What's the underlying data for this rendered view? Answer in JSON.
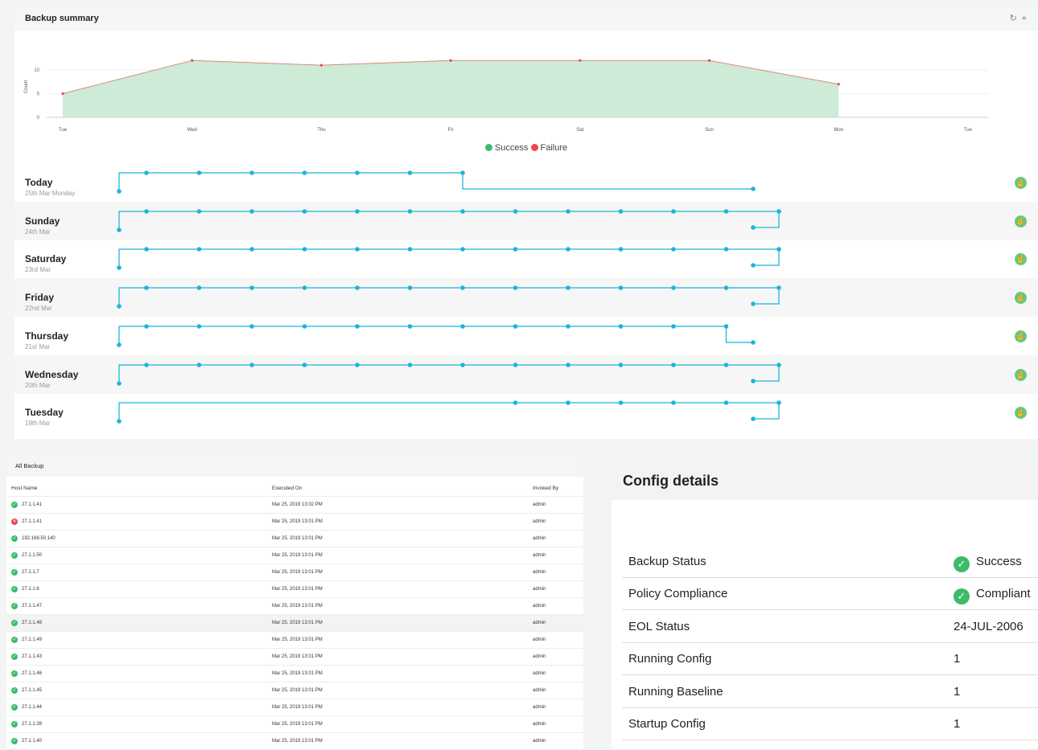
{
  "summary": {
    "title": "Backup summary",
    "icons": [
      "refresh-icon",
      "pin-icon"
    ],
    "ylabel": "Count",
    "legend": [
      {
        "label": "Success",
        "color": "#3dbb6a"
      },
      {
        "label": "Failure",
        "color": "#e8474f"
      }
    ]
  },
  "chart_data": {
    "type": "area",
    "categories": [
      "Tue",
      "Wed",
      "Thu",
      "Fri",
      "Sat",
      "Sun",
      "Mon",
      "Tue"
    ],
    "series": [
      {
        "name": "Success",
        "color": "#3dbb6a",
        "values": [
          5,
          12,
          11,
          12,
          12,
          12,
          7,
          null
        ]
      },
      {
        "name": "Failure",
        "color": "#e8474f",
        "values": [
          0,
          0,
          0,
          0,
          0,
          0,
          0,
          null
        ]
      }
    ],
    "yticks": [
      0,
      5,
      10
    ],
    "ylim": [
      0,
      12
    ],
    "ylabel": "Count",
    "xlabel": "",
    "grid": true,
    "legend": "bottom-center"
  },
  "timeline": {
    "line_color": "#1bb5db",
    "days": [
      {
        "day": "Today",
        "date": "25th Mar Monday",
        "status": "up-vote",
        "slots": [
          1,
          1,
          1,
          1,
          1,
          1,
          1,
          0,
          0,
          0,
          0,
          0,
          0
        ],
        "last_index": 6
      },
      {
        "day": "Sunday",
        "date": "24th Mar",
        "status": "up-vote",
        "slots": [
          1,
          1,
          1,
          1,
          1,
          1,
          1,
          1,
          1,
          1,
          1,
          1,
          1
        ],
        "last_index": 12
      },
      {
        "day": "Saturday",
        "date": "23rd Mar",
        "status": "up-vote",
        "slots": [
          1,
          1,
          1,
          1,
          1,
          1,
          1,
          1,
          1,
          1,
          1,
          1,
          1
        ],
        "last_index": 12
      },
      {
        "day": "Friday",
        "date": "22nd Mar",
        "status": "up-vote",
        "slots": [
          1,
          1,
          1,
          1,
          1,
          1,
          1,
          1,
          1,
          1,
          1,
          1,
          1
        ],
        "last_index": 12
      },
      {
        "day": "Thursday",
        "date": "21st Mar",
        "status": "up-vote",
        "slots": [
          1,
          1,
          1,
          1,
          1,
          1,
          1,
          1,
          1,
          1,
          1,
          1,
          0
        ],
        "last_index": 11
      },
      {
        "day": "Wednesday",
        "date": "20th Mar",
        "status": "up-vote",
        "slots": [
          1,
          1,
          1,
          1,
          1,
          1,
          1,
          1,
          1,
          1,
          1,
          1,
          1
        ],
        "last_index": 12
      },
      {
        "day": "Tuesday",
        "date": "19th Mar",
        "status": "up-vote",
        "slots": [
          0,
          0,
          0,
          0,
          0,
          0,
          0,
          1,
          1,
          1,
          1,
          1,
          1
        ],
        "last_index": 12
      }
    ]
  },
  "all_backup": {
    "title": "All Backup",
    "headers": {
      "host": "Host Name",
      "executed": "Executed On",
      "invoked": "Invoked By"
    },
    "rows": [
      {
        "host": "27.1.1.41",
        "executed": "Mar 25, 2019 13:02 PM",
        "by": "admin",
        "status": "success"
      },
      {
        "host": "27.1.1.41",
        "executed": "Mar 25, 2019 13:01 PM",
        "by": "admin",
        "status": "failure"
      },
      {
        "host": "192.168.50.140",
        "executed": "Mar 25, 2019 13:01 PM",
        "by": "admin",
        "status": "success"
      },
      {
        "host": "27.1.1.50",
        "executed": "Mar 25, 2019 13:01 PM",
        "by": "admin",
        "status": "success"
      },
      {
        "host": "27.1.1.7",
        "executed": "Mar 25, 2019 13:01 PM",
        "by": "admin",
        "status": "success"
      },
      {
        "host": "27.1.1.6",
        "executed": "Mar 25, 2019 13:01 PM",
        "by": "admin",
        "status": "success"
      },
      {
        "host": "27.1.1.47",
        "executed": "Mar 25, 2019 13:01 PM",
        "by": "admin",
        "status": "success"
      },
      {
        "host": "27.1.1.48",
        "executed": "Mar 25, 2019 13:01 PM",
        "by": "admin",
        "status": "success",
        "hovered": true
      },
      {
        "host": "27.1.1.49",
        "executed": "Mar 25, 2019 13:01 PM",
        "by": "admin",
        "status": "success"
      },
      {
        "host": "27.1.1.43",
        "executed": "Mar 25, 2019 13:01 PM",
        "by": "admin",
        "status": "success"
      },
      {
        "host": "27.1.1.46",
        "executed": "Mar 25, 2019 13:01 PM",
        "by": "admin",
        "status": "success"
      },
      {
        "host": "27.1.1.45",
        "executed": "Mar 25, 2019 13:01 PM",
        "by": "admin",
        "status": "success"
      },
      {
        "host": "27.1.1.44",
        "executed": "Mar 25, 2019 13:01 PM",
        "by": "admin",
        "status": "success"
      },
      {
        "host": "27.1.1.39",
        "executed": "Mar 25, 2019 13:01 PM",
        "by": "admin",
        "status": "success"
      },
      {
        "host": "27.1.1.40",
        "executed": "Mar 25, 2019 13:01 PM",
        "by": "admin",
        "status": "success"
      }
    ]
  },
  "config": {
    "title": "Config details",
    "rows": [
      {
        "label": "Backup Status",
        "value": "Success",
        "icon": "check-circle-icon"
      },
      {
        "label": "Policy Compliance",
        "value": "Compliant",
        "icon": "check-circle-icon"
      },
      {
        "label": "EOL Status",
        "value": "24-JUL-2006"
      },
      {
        "label": "Running Config",
        "value": "1"
      },
      {
        "label": "Running Baseline",
        "value": "1"
      },
      {
        "label": "Startup Config",
        "value": "1"
      }
    ]
  }
}
